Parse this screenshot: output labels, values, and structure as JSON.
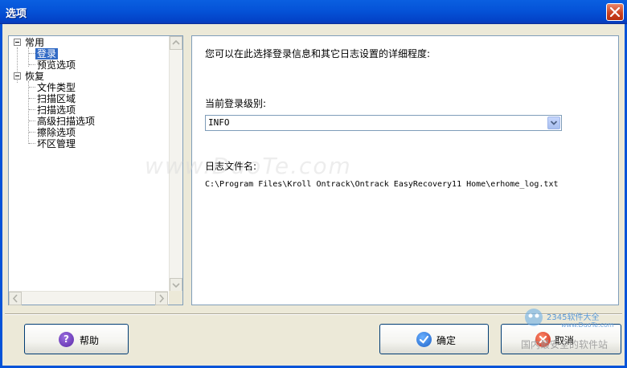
{
  "window": {
    "title": "选项"
  },
  "tree": {
    "items": [
      {
        "label": "常用",
        "level": 0,
        "expanded": true
      },
      {
        "label": "登录",
        "level": 1,
        "selected": true
      },
      {
        "label": "预览选项",
        "level": 1
      },
      {
        "label": "恢复",
        "level": 0,
        "expanded": true
      },
      {
        "label": "文件类型",
        "level": 1
      },
      {
        "label": "扫描区域",
        "level": 1
      },
      {
        "label": "扫描选项",
        "level": 1
      },
      {
        "label": "高级扫描选项",
        "level": 1
      },
      {
        "label": "擦除选项",
        "level": 1
      },
      {
        "label": "坏区管理",
        "level": 1
      }
    ]
  },
  "content": {
    "description": "您可以在此选择登录信息和其它日志设置的详细程度:",
    "level_label": "当前登录级别:",
    "level_value": "INFO",
    "logfile_label": "日志文件名:",
    "logfile_path": "C:\\Program Files\\Kroll Ontrack\\Ontrack EasyRecovery11 Home\\erhome_log.txt"
  },
  "buttons": {
    "help": "帮助",
    "ok": "确定",
    "cancel": "取消"
  },
  "watermark": {
    "bg_text": "www.DuoTe.com",
    "brand": "2345软件大全",
    "domain": "www.DuoTe.com",
    "tagline": "国内最安全的软件站"
  },
  "colors": {
    "titlebar": "#0553d8",
    "selection": "#316ac5",
    "border": "#7f9db9",
    "dialog_bg": "#ece9d8"
  }
}
